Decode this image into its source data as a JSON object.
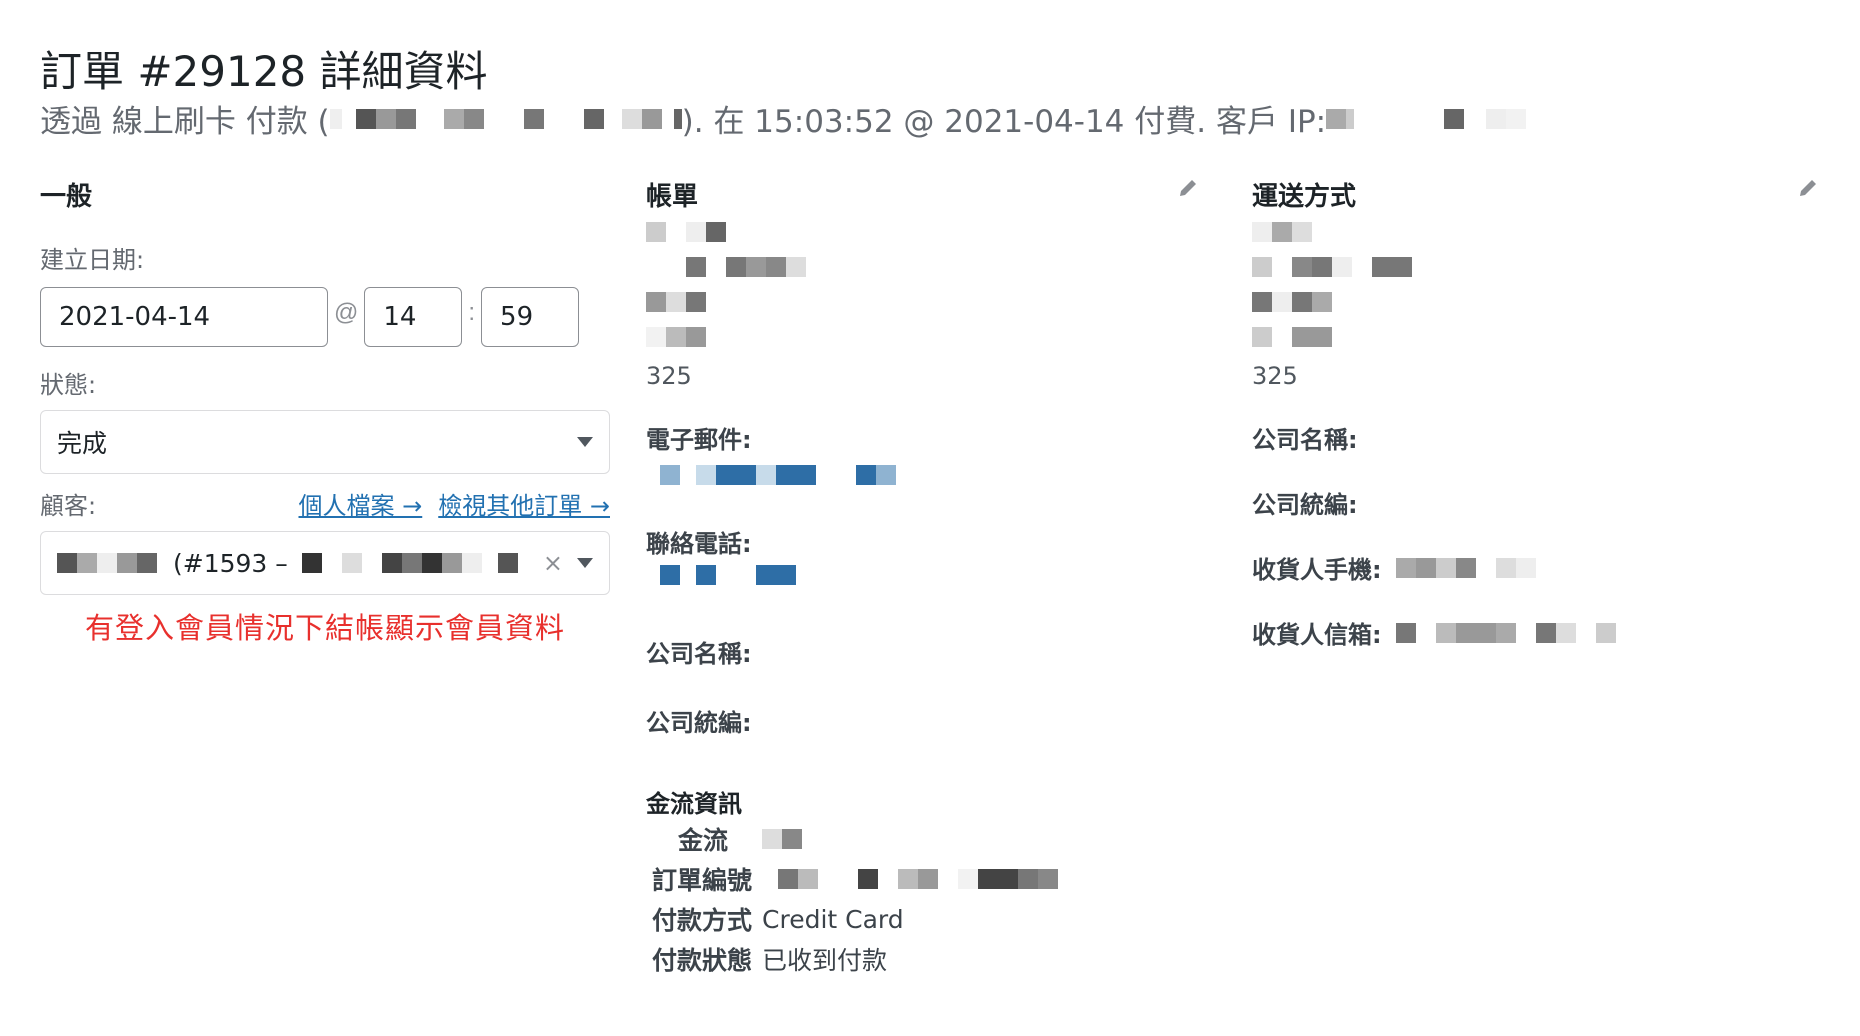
{
  "page": {
    "title": "訂單 #29128 詳細資料",
    "subtitle_prefix": "透過 線上刷卡 付款 (",
    "subtitle_suffix": "). 在 15:03:52 @ 2021-04-14 付費. 客戶 IP: "
  },
  "general": {
    "heading": "一般",
    "created_label": "建立日期:",
    "date_value": "2021-04-14",
    "at_sep": "@",
    "hour_value": "14",
    "colon_sep": ":",
    "minute_value": "59",
    "status_label": "狀態:",
    "status_value": "完成",
    "customer_label": "顧客:",
    "profile_link": "個人檔案 →",
    "other_orders_link": "檢視其他訂單 →",
    "customer_value": "(#1593 –",
    "clear_glyph": "×",
    "annotation": "有登入會員情況下結帳顯示會員資料"
  },
  "billing": {
    "heading": "帳單",
    "postcode": "325",
    "email_label": "電子郵件:",
    "phone_label": "聯絡電話:",
    "company_name_label": "公司名稱:",
    "company_tax_label": "公司統編:",
    "payment_info_heading": "金流資訊",
    "gateway_label": "金流",
    "order_no_label": "訂單編號",
    "pay_method_label": "付款方式",
    "pay_method_value": "Credit Card",
    "pay_status_label": "付款狀態",
    "pay_status_value": "已收到付款"
  },
  "shipping": {
    "heading": "運送方式",
    "postcode": "325",
    "company_name_label": "公司名稱:",
    "company_tax_label": "公司統編:",
    "receiver_phone_label": "收貨人手機:",
    "receiver_email_label": "收貨人信箱:"
  },
  "icons": {
    "edit": "pencil-icon",
    "dropdown": "chevron-down-icon"
  },
  "colors": {
    "link": "#2271b1",
    "annotation": "#e8302d",
    "redact_blue": "#2e6ea6"
  }
}
